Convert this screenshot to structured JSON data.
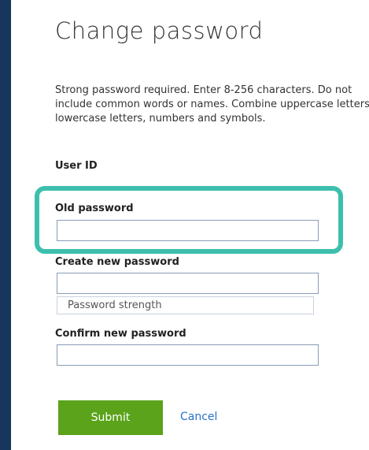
{
  "form": {
    "title": "Change password",
    "description": "Strong password required. Enter 8-256 characters. Do not include common words or names. Combine uppercase letters, lowercase letters, numbers and symbols.",
    "user_id_label": "User ID",
    "old_password_label": "Old password",
    "old_password_value": "",
    "new_password_label": "Create new password",
    "new_password_value": "",
    "strength_label": "Password strength",
    "confirm_password_label": "Confirm new password",
    "confirm_password_value": "",
    "submit_label": "Submit",
    "cancel_label": "Cancel"
  },
  "colors": {
    "frame_background": "#17365d",
    "highlight_border": "#3dbfae",
    "submit_background": "#5aa31a",
    "link": "#2b72c9"
  }
}
